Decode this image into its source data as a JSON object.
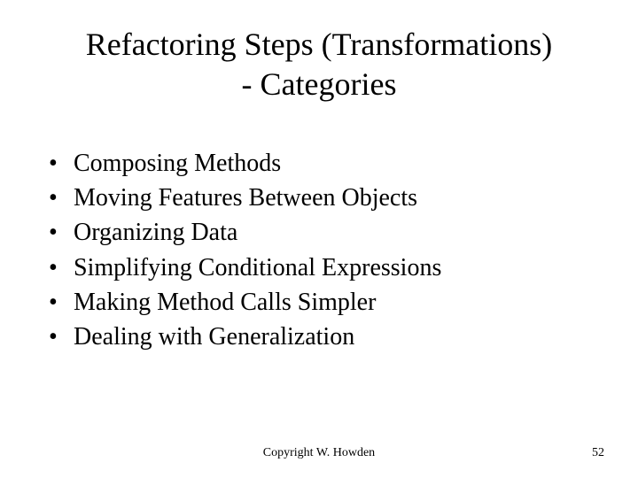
{
  "title_line1": "Refactoring Steps (Transformations)",
  "title_line2": "- Categories",
  "bullets": {
    "b0": "Composing Methods",
    "b1": "Moving Features Between Objects",
    "b2": "Organizing Data",
    "b3": "Simplifying Conditional Expressions",
    "b4": "Making Method Calls Simpler",
    "b5": "Dealing with Generalization"
  },
  "footer": {
    "copyright": "Copyright W. Howden",
    "page": "52"
  },
  "dot": "•"
}
